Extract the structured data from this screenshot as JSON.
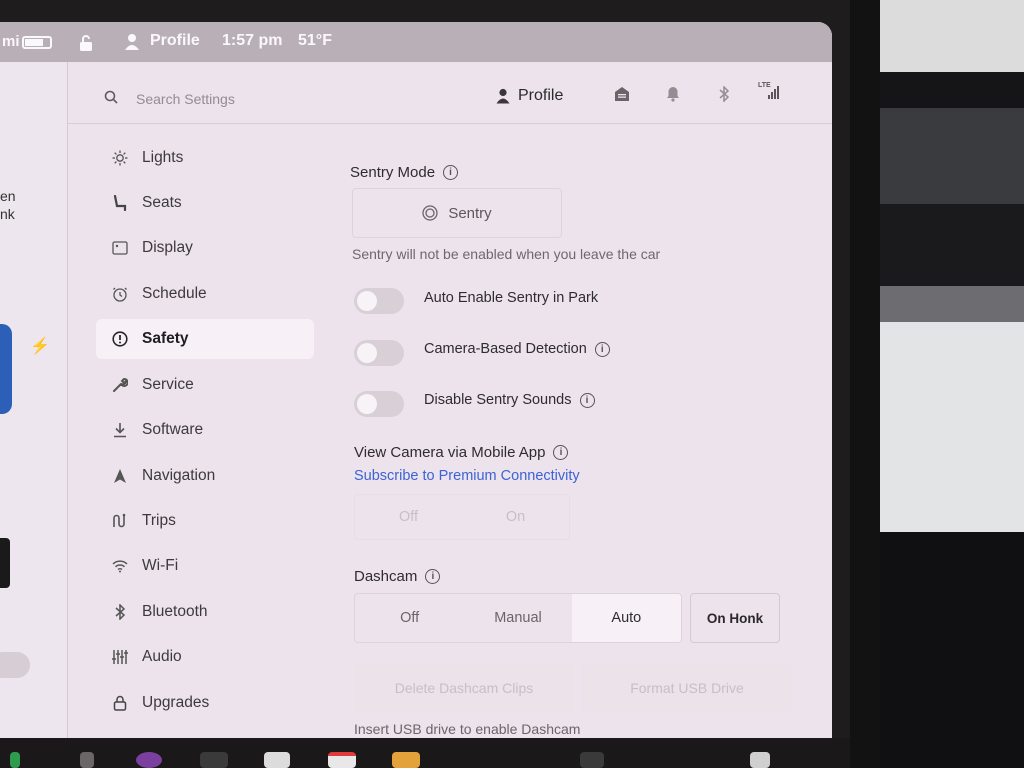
{
  "statusbar": {
    "range_unit": "mi",
    "profile": "Profile",
    "time": "1:57 pm",
    "temperature": "51°F"
  },
  "carpanel": {
    "text_line1": "en",
    "text_line2": "nk"
  },
  "topbar": {
    "search_placeholder": "Search Settings",
    "profile_label": "Profile",
    "lte_label": "LTE"
  },
  "sidebar": {
    "items": [
      {
        "label": "Lights",
        "icon": "sun-icon"
      },
      {
        "label": "Seats",
        "icon": "seat-icon"
      },
      {
        "label": "Display",
        "icon": "display-icon"
      },
      {
        "label": "Schedule",
        "icon": "clock-icon"
      },
      {
        "label": "Safety",
        "icon": "alert-circle-icon",
        "active": true
      },
      {
        "label": "Service",
        "icon": "wrench-icon"
      },
      {
        "label": "Software",
        "icon": "download-icon"
      },
      {
        "label": "Navigation",
        "icon": "navigation-arrow-icon"
      },
      {
        "label": "Trips",
        "icon": "trips-icon"
      },
      {
        "label": "Wi-Fi",
        "icon": "wifi-icon"
      },
      {
        "label": "Bluetooth",
        "icon": "bluetooth-icon"
      },
      {
        "label": "Audio",
        "icon": "equalizer-icon"
      },
      {
        "label": "Upgrades",
        "icon": "lock-icon"
      }
    ]
  },
  "content": {
    "sentry_mode_title": "Sentry Mode",
    "sentry_button": "Sentry",
    "sentry_note": "Sentry will not be enabled when you leave the car",
    "toggles": [
      {
        "label": "Auto Enable Sentry in Park",
        "info": false
      },
      {
        "label": "Camera-Based Detection",
        "info": true
      },
      {
        "label": "Disable Sentry Sounds",
        "info": true
      }
    ],
    "view_camera_title": "View Camera via Mobile App",
    "subscribe_link": "Subscribe to Premium Connectivity",
    "view_camera_options": [
      "Off",
      "On"
    ],
    "dashcam_title": "Dashcam",
    "dashcam_options": [
      "Off",
      "Manual",
      "Auto"
    ],
    "dashcam_selected": "Auto",
    "on_honk_button": "On Honk",
    "delete_clips_button": "Delete Dashcam Clips",
    "format_usb_button": "Format USB Drive",
    "usb_note": "Insert USB drive to enable Dashcam"
  },
  "colors": {
    "accent_link": "#3d63d6",
    "background": "#ece3ec",
    "statusbar": "#b8b0b6"
  }
}
